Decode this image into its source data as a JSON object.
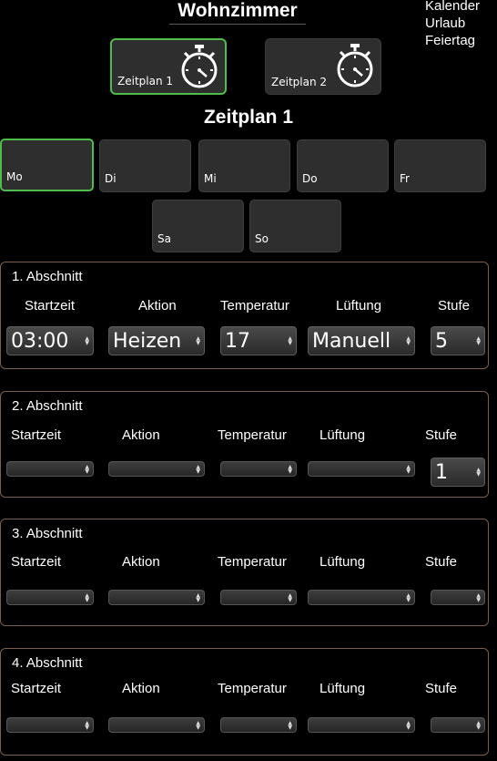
{
  "header": {
    "room_title": "Wohnzimmer"
  },
  "side_menu": [
    {
      "label": "Kalender"
    },
    {
      "label": "Urlaub"
    },
    {
      "label": "Feiertag"
    }
  ],
  "schedules": [
    {
      "label": "Zeitplan 1",
      "icon": "stopwatch-icon",
      "active": true
    },
    {
      "label": "Zeitplan 2",
      "icon": "stopwatch-icon",
      "active": false
    }
  ],
  "current_schedule_title": "Zeitplan 1",
  "days": [
    {
      "label": "Mo",
      "active": true
    },
    {
      "label": "Di",
      "active": false
    },
    {
      "label": "Mi",
      "active": false
    },
    {
      "label": "Do",
      "active": false
    },
    {
      "label": "Fr",
      "active": false
    },
    {
      "label": "Sa",
      "active": false
    },
    {
      "label": "So",
      "active": false
    }
  ],
  "columns": {
    "startzeit": "Startzeit",
    "aktion": "Aktion",
    "temperatur": "Temperatur",
    "lueftung": "Lüftung",
    "stufe": "Stufe"
  },
  "sections": [
    {
      "title": "1. Abschnitt",
      "startzeit": "03:00",
      "aktion": "Heizen",
      "temperatur": "17",
      "lueftung": "Manuell",
      "stufe": "5"
    },
    {
      "title": "2. Abschnitt",
      "startzeit": "",
      "aktion": "",
      "temperatur": "",
      "lueftung": "",
      "stufe": "1"
    },
    {
      "title": "3. Abschnitt",
      "startzeit": "",
      "aktion": "",
      "temperatur": "",
      "lueftung": "",
      "stufe": ""
    },
    {
      "title": "4. Abschnitt",
      "startzeit": "",
      "aktion": "",
      "temperatur": "",
      "lueftung": "",
      "stufe": ""
    }
  ],
  "colors": {
    "active_border": "#4fbd4a",
    "section_border": "#7a5f4e",
    "background": "#000000"
  }
}
